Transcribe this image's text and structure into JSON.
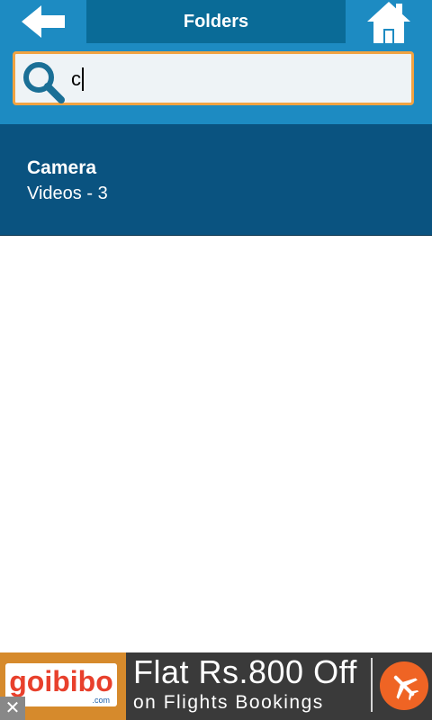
{
  "header": {
    "title": "Folders",
    "back_icon": "arrow-left-icon",
    "home_icon": "home-icon"
  },
  "search": {
    "value": "c",
    "icon": "search-icon"
  },
  "folders": [
    {
      "name": "Camera",
      "subtitle": "Videos - 3"
    }
  ],
  "ad": {
    "brand": "goibibo",
    "brand_suffix": ".com",
    "headline": "Flat Rs.800 Off",
    "subline": "on Flights Bookings",
    "close_label": "✕",
    "plane_icon": "airplane-icon"
  },
  "colors": {
    "topbar": "#0a6b97",
    "button": "#1d8bc2",
    "list_item": "#0a5380",
    "search_border": "#f0a342",
    "ad_accent": "#ef6424"
  }
}
